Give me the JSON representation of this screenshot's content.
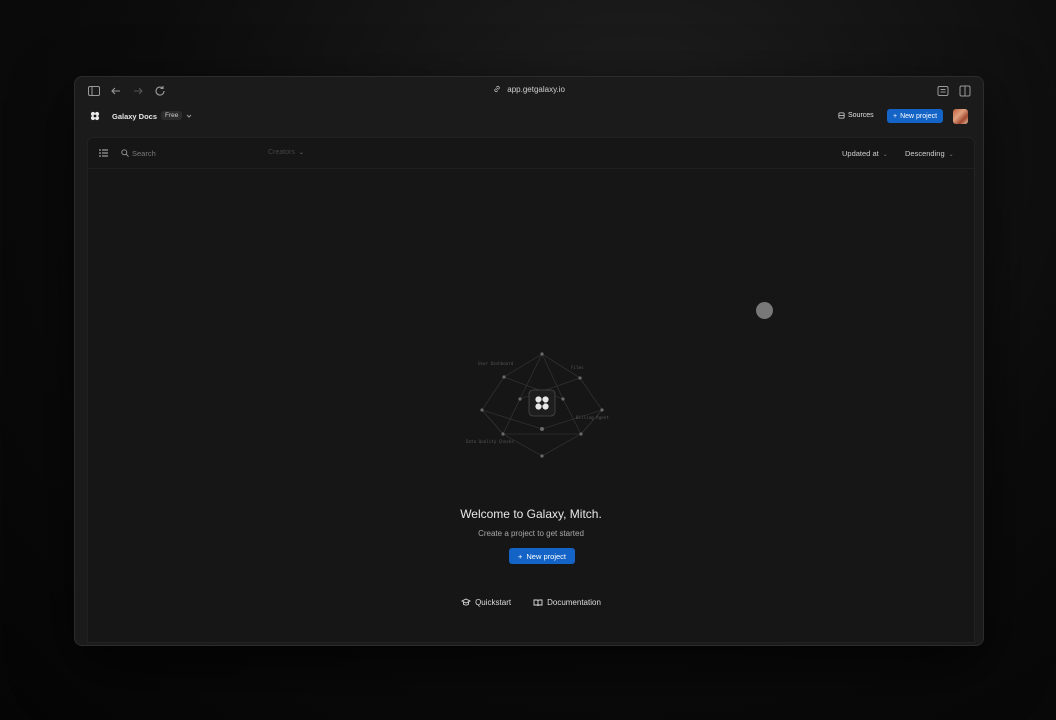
{
  "browser": {
    "url": "app.getgalaxy.io"
  },
  "app": {
    "workspace_name": "Galaxy Docs",
    "plan_badge": "Free",
    "sources_label": "Sources",
    "new_project_label": "New project"
  },
  "toolbar": {
    "search_placeholder": "Search",
    "creator_filter_label": "Creators",
    "sort_field_label": "Updated at",
    "sort_order_label": "Descending"
  },
  "graphic": {
    "labels": [
      "User Dashboard",
      "Films",
      "Billing Agent",
      "Data Quality Checks"
    ]
  },
  "empty_state": {
    "welcome_text": "Welcome to Galaxy, Mitch.",
    "subtitle": "Create a project to get started",
    "new_project_label": "New project",
    "quickstart_label": "Quickstart",
    "documentation_label": "Documentation"
  },
  "colors": {
    "accent": "#1463c7",
    "background": "#161616"
  }
}
